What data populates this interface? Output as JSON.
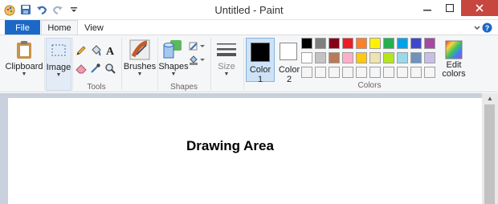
{
  "window": {
    "title": "Untitled - Paint"
  },
  "tabs": {
    "file": "File",
    "home": "Home",
    "view": "View"
  },
  "clipboard": {
    "label": "Clipboard"
  },
  "image": {
    "label": "Image"
  },
  "tools": {
    "label": "Tools"
  },
  "brushes": {
    "label": "Brushes"
  },
  "shapes": {
    "button_label": "Shapes",
    "group_label": "Shapes"
  },
  "size": {
    "label": "Size"
  },
  "colors": {
    "color1_label": "Color",
    "color1_num": "1",
    "color2_label": "Color",
    "color2_num": "2",
    "group_label": "Colors",
    "edit_line1": "Edit",
    "edit_line2": "colors",
    "row1": [
      "#000000",
      "#7f7f7f",
      "#880015",
      "#ed1c24",
      "#ff7f27",
      "#fff200",
      "#22b14c",
      "#00a2e8",
      "#3f48cc",
      "#a349a4"
    ],
    "row2": [
      "#ffffff",
      "#c3c3c3",
      "#b97a57",
      "#ffaec9",
      "#ffc90e",
      "#efe4b0",
      "#b5e61d",
      "#99d9ea",
      "#7092be",
      "#c8bfe7"
    ],
    "row3": [
      "#f5f5f5",
      "#f5f5f5",
      "#f5f5f5",
      "#f5f5f5",
      "#f5f5f5",
      "#f5f5f5",
      "#f5f5f5",
      "#f5f5f5",
      "#f5f5f5",
      "#f5f5f5"
    ]
  },
  "canvas": {
    "text": "Drawing Area"
  }
}
